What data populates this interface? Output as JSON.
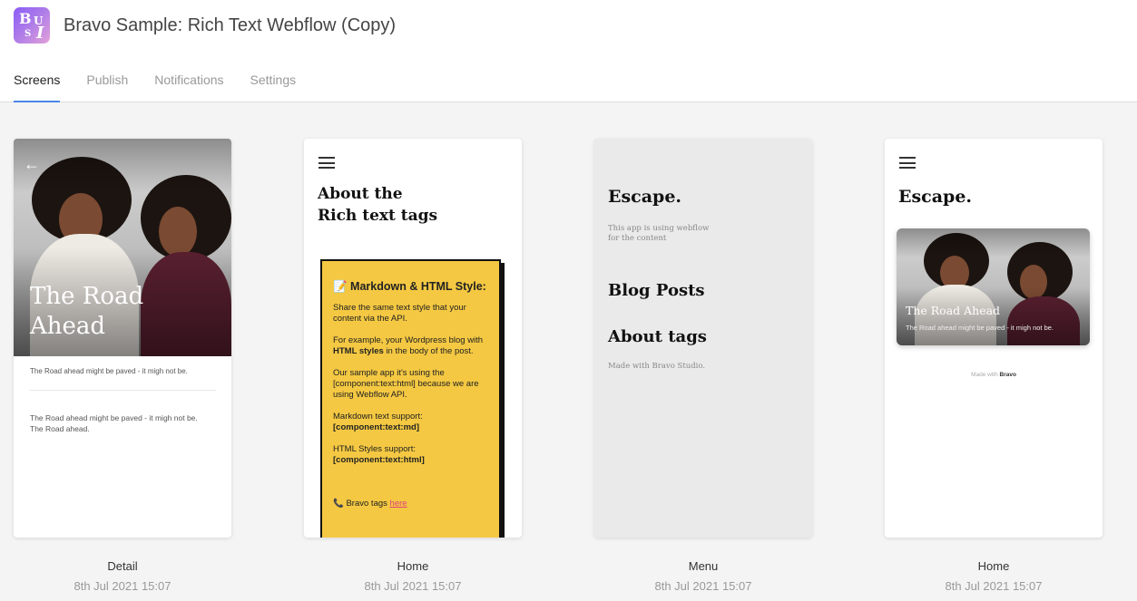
{
  "app": {
    "title": "Bravo Sample: Rich Text Webflow (Copy)",
    "logo_letters": [
      "B",
      "U",
      "S",
      "I"
    ]
  },
  "tabs": [
    {
      "label": "Screens",
      "active": true
    },
    {
      "label": "Publish",
      "active": false
    },
    {
      "label": "Notifications",
      "active": false
    },
    {
      "label": "Settings",
      "active": false
    }
  ],
  "screens": [
    {
      "name": "Detail",
      "date": "8th Jul 2021 15:07",
      "hero_title_l1": "The Road",
      "hero_title_l2": "Ahead",
      "line1": "The Road ahead might be paved - it migh not be.",
      "line2": "The Road ahead might be paved - it migh not be. The Road ahead."
    },
    {
      "name": "Home",
      "date": "8th Jul 2021 15:07",
      "heading_l1": "About the",
      "heading_l2": "Rich text tags",
      "box_title": "📝 Markdown & HTML Style:",
      "p1": "Share the same text style that your content via the API.",
      "p2_pre": "For example, your Wordpress blog with ",
      "p2_bold": "HTML styles",
      "p2_post": " in the body of the post.",
      "p3": "Our sample app it's using the [component:text:html] because we are using Webflow API.",
      "p4_label": "Markdown text support:",
      "p4_code": "[component:text:md]",
      "p5_label": " HTML Styles support:",
      "p5_code": "[component:text:html]",
      "footer_pre": "📞 Bravo tags ",
      "footer_link": "here"
    },
    {
      "name": "Menu",
      "date": "8th Jul 2021 15:07",
      "brand": "Escape.",
      "subtitle_l1": "This app is using webflow",
      "subtitle_l2": "for the content",
      "item1": "Blog Posts",
      "item2": "About tags",
      "footer": "Made with Bravo Studio."
    },
    {
      "name": "Home",
      "date": "8th Jul 2021 15:07",
      "brand": "Escape.",
      "card_title": "The Road Ahead",
      "card_sub": "The Road ahead might be paved - it migh not be.",
      "footer_pre": "Made with",
      "footer_brand": "Bravo"
    }
  ],
  "colors": {
    "accent": "#4a86e8",
    "note_yellow": "#f4c842",
    "link_pink": "#e0457b",
    "menu_bg": "#eaeaea"
  }
}
